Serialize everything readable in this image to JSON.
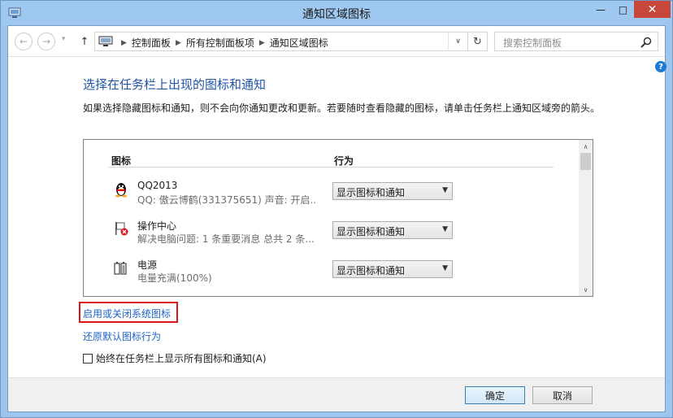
{
  "window": {
    "title": "通知区域图标",
    "minimize": "—",
    "maximize": "□",
    "close": "✕"
  },
  "nav": {
    "back": "←",
    "forward": "→",
    "recent": "▾",
    "up": "↑",
    "breadcrumb_sep": "▶",
    "breadcrumbs": [
      "控制面板",
      "所有控制面板项",
      "通知区域图标"
    ],
    "address_dropdown": "∨",
    "refresh": "↻",
    "search_placeholder": "搜索控制面板"
  },
  "help": "?",
  "main": {
    "heading": "选择在任务栏上出现的图标和通知",
    "description": "如果选择隐藏图标和通知，则不会向你通知更改和更新。若要随时查看隐藏的图标，请单击任务栏上通知区域旁的箭头。",
    "columns": {
      "icon": "图标",
      "behavior": "行为"
    },
    "rows": [
      {
        "name": "QQ2013",
        "detail": "QQ: 傲云博鹤(331375651)  声音: 开启...",
        "behavior": "显示图标和通知",
        "icon": "penguin-icon"
      },
      {
        "name": "操作中心",
        "detail": "解决电脑问题: 1 条重要消息  总共 2 条...",
        "behavior": "显示图标和通知",
        "icon": "action-center-flag-icon"
      },
      {
        "name": "电源",
        "detail": "电量充满(100%)",
        "behavior": "显示图标和通知",
        "icon": "battery-icon"
      }
    ],
    "scroll_up": "∧",
    "scroll_down": "∨",
    "link_system_icons": "启用或关闭系统图标",
    "link_restore": "还原默认图标行为",
    "always_show_label": "始终在任务栏上显示所有图标和通知(A)",
    "always_show_checked": false
  },
  "footer": {
    "ok": "确定",
    "cancel": "取消"
  },
  "colors": {
    "heading": "#1f55a6",
    "link": "#1f64c4",
    "highlight": "#d8161c",
    "close_button": "#c7473a"
  }
}
